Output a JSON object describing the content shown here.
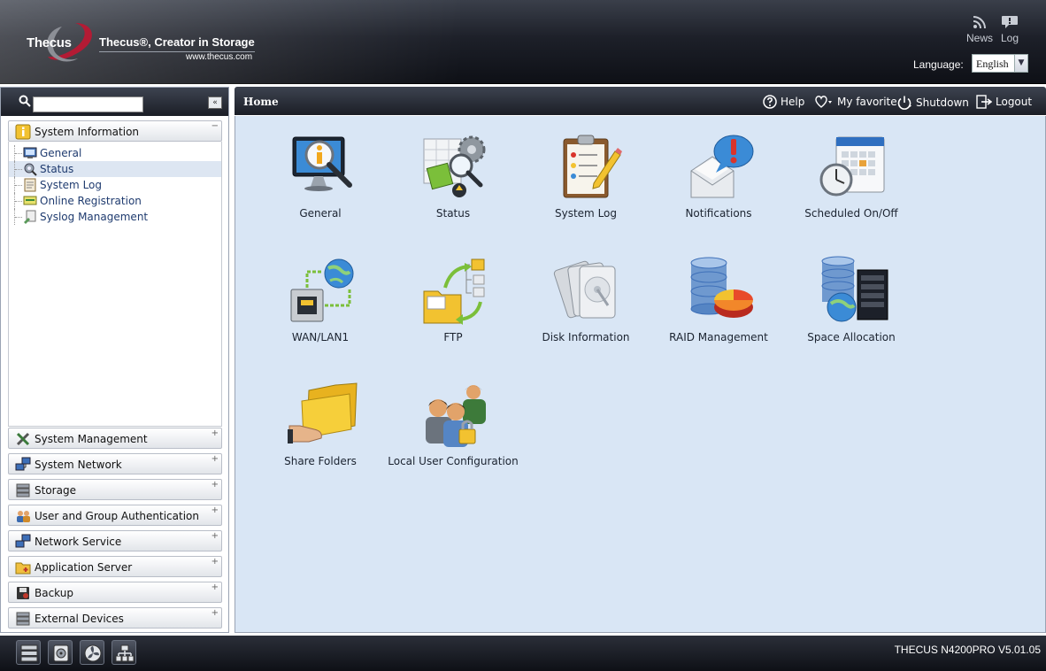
{
  "header": {
    "logo_text": "Thecus",
    "slogan": "Thecus®, Creator in Storage",
    "site_url": "www.thecus.com",
    "news_label": "News",
    "log_label": "Log",
    "language_label": "Language:",
    "language_value": "English"
  },
  "sidebar": {
    "search_placeholder": "",
    "categories": [
      {
        "label": "System Information",
        "toggle": "−",
        "icon": "info-icon"
      },
      {
        "label": "System Management",
        "toggle": "+",
        "icon": "tools-icon"
      },
      {
        "label": "System Network",
        "toggle": "+",
        "icon": "network-icon"
      },
      {
        "label": "Storage",
        "toggle": "+",
        "icon": "storage-icon"
      },
      {
        "label": "User and Group Authentication",
        "toggle": "+",
        "icon": "users-icon"
      },
      {
        "label": "Network Service",
        "toggle": "+",
        "icon": "network-service-icon"
      },
      {
        "label": "Application Server",
        "toggle": "+",
        "icon": "app-server-icon"
      },
      {
        "label": "Backup",
        "toggle": "+",
        "icon": "backup-icon"
      },
      {
        "label": "External Devices",
        "toggle": "+",
        "icon": "external-devices-icon"
      }
    ],
    "sysinfo_items": [
      {
        "label": "General",
        "icon": "monitor-icon",
        "selected": false
      },
      {
        "label": "Status",
        "icon": "status-icon",
        "selected": true
      },
      {
        "label": "System Log",
        "icon": "document-icon",
        "selected": false
      },
      {
        "label": "Online Registration",
        "icon": "registration-icon",
        "selected": false
      },
      {
        "label": "Syslog Management",
        "icon": "syslog-icon",
        "selected": false
      }
    ]
  },
  "topbar": {
    "breadcrumb": "Home",
    "help_label": "Help",
    "favorite_label": "My favorite",
    "shutdown_label": "Shutdown",
    "logout_label": "Logout"
  },
  "tiles": [
    {
      "label": "General",
      "icon": "general-monitor-icon"
    },
    {
      "label": "Status",
      "icon": "status-gears-icon"
    },
    {
      "label": "System Log",
      "icon": "clipboard-log-icon"
    },
    {
      "label": "Notifications",
      "icon": "notification-mail-icon"
    },
    {
      "label": "Scheduled On/Off",
      "icon": "calendar-clock-icon"
    },
    {
      "label": "WAN/LAN1",
      "icon": "network-port-icon"
    },
    {
      "label": "FTP",
      "icon": "ftp-folder-icon"
    },
    {
      "label": "Disk Information",
      "icon": "disk-icon"
    },
    {
      "label": "RAID Management",
      "icon": "raid-database-icon"
    },
    {
      "label": "Space Allocation",
      "icon": "space-allocation-icon"
    },
    {
      "label": "Share Folders",
      "icon": "share-folder-icon"
    },
    {
      "label": "Local User Configuration",
      "icon": "local-users-icon"
    }
  ],
  "footer": {
    "device_model": "THECUS N4200PRO V5.01.05"
  },
  "colors": {
    "content_bg": "#d9e6f5",
    "header_dark": "#1d2029",
    "logo_red": "#b31b34"
  }
}
